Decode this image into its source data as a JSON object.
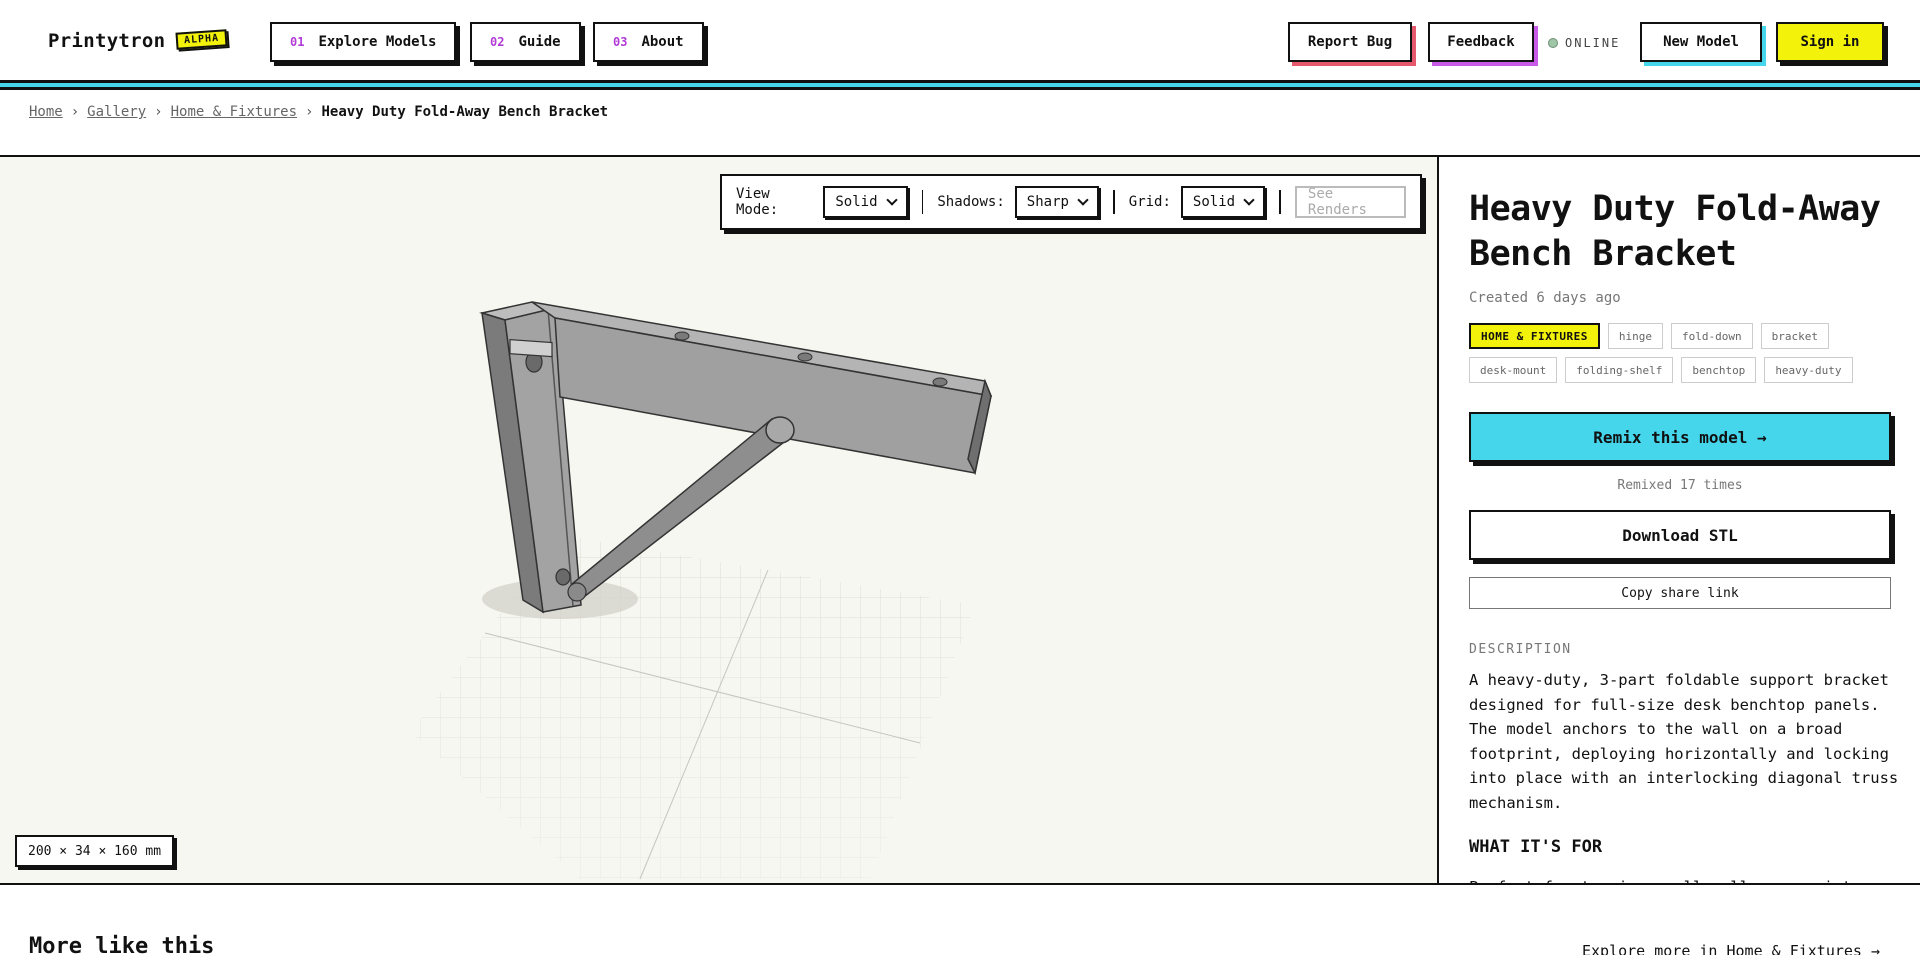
{
  "header": {
    "logo": "Printytron",
    "badge": "ALPHA",
    "nav": [
      {
        "num": "01",
        "label": "Explore Models"
      },
      {
        "num": "02",
        "label": "Guide"
      },
      {
        "num": "03",
        "label": "About"
      }
    ],
    "report_bug": "Report Bug",
    "feedback": "Feedback",
    "status": "ONLINE",
    "new_model": "New Model",
    "sign_in": "Sign in"
  },
  "breadcrumb": {
    "items": [
      "Home",
      "Gallery",
      "Home & Fixtures"
    ],
    "separator": "›",
    "current": "Heavy Duty Fold-Away Bench Bracket"
  },
  "viewer": {
    "view_mode_label": "View Mode:",
    "view_mode_value": "Solid",
    "shadows_label": "Shadows:",
    "shadows_value": "Sharp",
    "grid_label": "Grid:",
    "grid_value": "Solid",
    "see_renders": "See Renders",
    "dimensions": "200 × 34 × 160 mm"
  },
  "model": {
    "title": "Heavy Duty Fold-Away Bench Bracket",
    "created": "Created 6 days ago",
    "tags": [
      "HOME & FIXTURES",
      "hinge",
      "fold-down",
      "bracket",
      "desk-mount",
      "folding-shelf",
      "benchtop",
      "heavy-duty"
    ],
    "remix_label": "Remix this model →",
    "remixed": "Remixed 17 times",
    "download_label": "Download STL",
    "share_label": "Copy share link",
    "description_label": "DESCRIPTION",
    "description": "A heavy-duty, 3-part foldable support bracket designed for full-size desk benchtop panels. The model anchors to the wall on a broad footprint, deploying horizontally and locking into place with an interlocking diagonal truss mechanism.",
    "whatfor_label": "WHAT IT'S FOR",
    "whatfor_text": "Perfect for turning small wall spaces into"
  },
  "more": {
    "title": "More like this",
    "link": "Explore more in Home & Fixtures →"
  },
  "colors": {
    "accent_cyan": "#45d6ec",
    "accent_yellow": "#f2f20a",
    "accent_purple": "#b13bd6",
    "report_bug_shadow": "#e6586e",
    "feedback_shadow": "#c85ce8",
    "new_model_shadow": "#45d6ec",
    "sign_in_bg": "#f2f20a",
    "viewer_bg": "#f7f7f1",
    "model_grey": "#9b9b9b"
  }
}
